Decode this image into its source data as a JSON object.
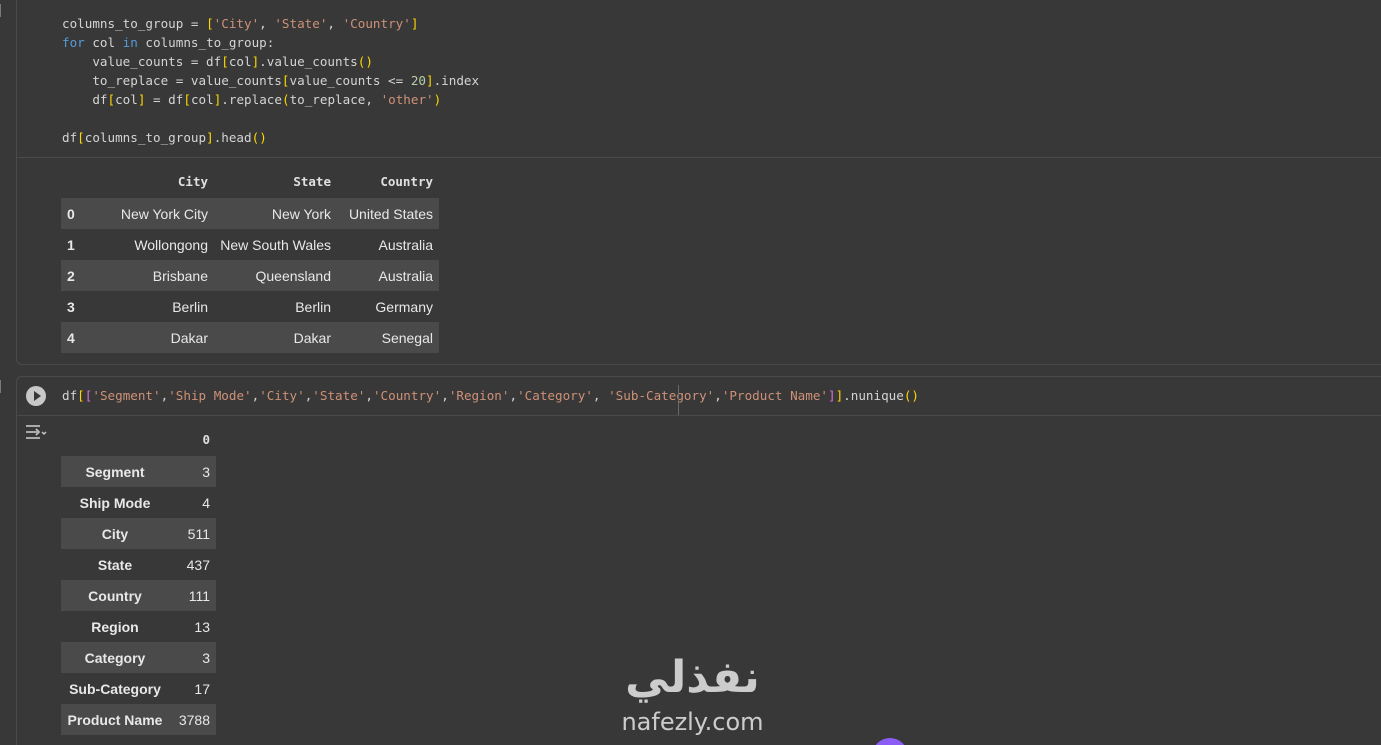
{
  "cell1": {
    "code_lines": [
      "columns_to_group = ['City', 'State', 'Country']",
      "for col in columns_to_group:",
      "    value_counts = df[col].value_counts()",
      "    to_replace = value_counts[value_counts <= 20].index",
      "    df[col] = df[col].replace(to_replace, 'other')",
      "",
      "df[columns_to_group].head()"
    ],
    "table": {
      "columns": [
        "",
        "City",
        "State",
        "Country"
      ],
      "rows": [
        {
          "index": "0",
          "City": "New York City",
          "State": "New York",
          "Country": "United States"
        },
        {
          "index": "1",
          "City": "Wollongong",
          "State": "New South Wales",
          "Country": "Australia"
        },
        {
          "index": "2",
          "City": "Brisbane",
          "State": "Queensland",
          "Country": "Australia"
        },
        {
          "index": "3",
          "City": "Berlin",
          "State": "Berlin",
          "Country": "Germany"
        },
        {
          "index": "4",
          "City": "Dakar",
          "State": "Dakar",
          "Country": "Senegal"
        }
      ]
    }
  },
  "cell2": {
    "code": "df[['Segment','Ship Mode','City','State','Country','Region','Category', 'Sub-Category','Product Name']].nunique()",
    "run_button_icon": "play-icon",
    "output_icon": "output-toggle-icon",
    "table": {
      "column": "0",
      "rows": [
        {
          "label": "Segment",
          "value": "3"
        },
        {
          "label": "Ship Mode",
          "value": "4"
        },
        {
          "label": "City",
          "value": "511"
        },
        {
          "label": "State",
          "value": "437"
        },
        {
          "label": "Country",
          "value": "111"
        },
        {
          "label": "Region",
          "value": "13"
        },
        {
          "label": "Category",
          "value": "3"
        },
        {
          "label": "Sub-Category",
          "value": "17"
        },
        {
          "label": "Product Name",
          "value": "3788"
        }
      ]
    }
  },
  "watermark": {
    "arabic": "نفذلي",
    "latin": "nafezly.com"
  },
  "colors": {
    "background": "#383838",
    "keyword": "#569cd6",
    "string": "#ce9178",
    "number": "#b5cea8",
    "table_stripe": "#4a4a4a"
  }
}
